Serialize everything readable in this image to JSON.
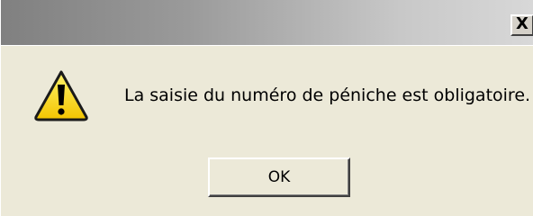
{
  "window": {
    "title": "",
    "close_label": "X"
  },
  "dialog": {
    "icon": "warning-icon",
    "message": "La saisie du numéro de péniche est obligatoire.",
    "ok_label": "OK"
  },
  "colors": {
    "background": "#ece9d8",
    "titlebar_start": "#808080",
    "titlebar_end": "#d8d8d8",
    "warning_fill": "#ffd800",
    "warning_outline": "#000000"
  }
}
